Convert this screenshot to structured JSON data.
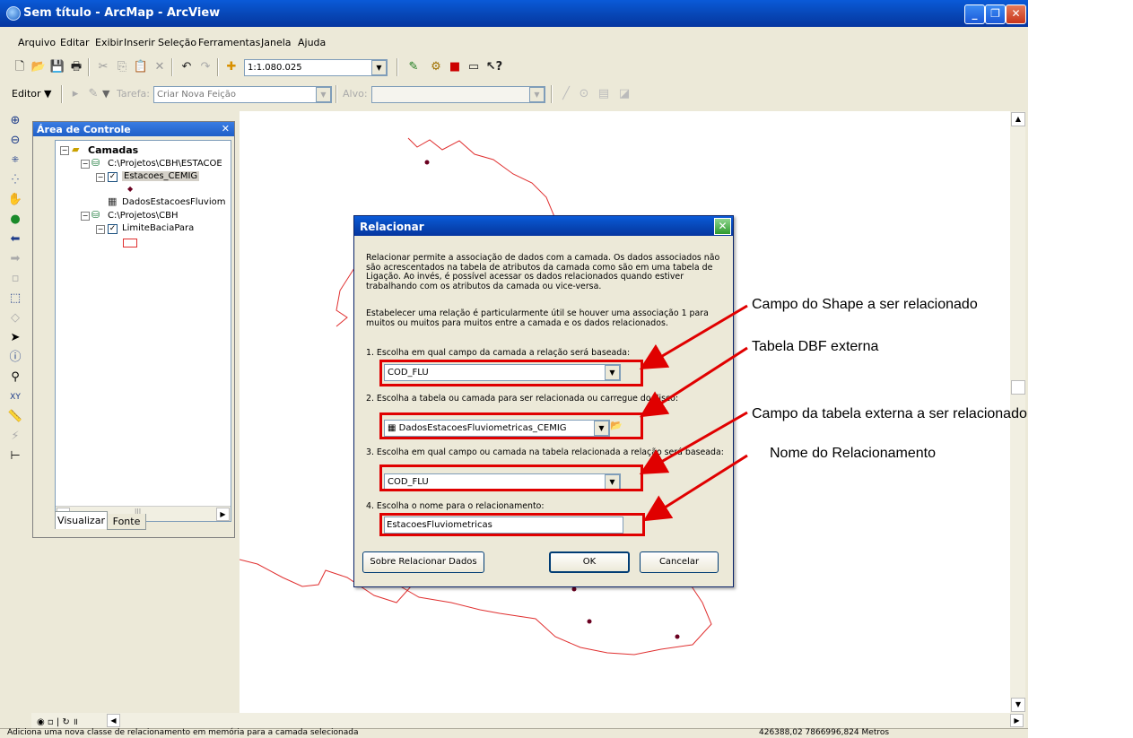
{
  "window": {
    "title": "Sem título - ArcMap - ArcView"
  },
  "menu": [
    "Arquivo",
    "Editar",
    "Exibir",
    "Inserir",
    "Seleção",
    "Ferramentas",
    "Janela",
    "Ajuda"
  ],
  "toolbar": {
    "scale": "1:1.080.025"
  },
  "editor": {
    "editor_label": "Editor",
    "task_label": "Tarefa:",
    "task_value": "Criar Nova Feição",
    "target_label": "Alvo:"
  },
  "toc": {
    "title": "Área de Controle",
    "root": "Camadas",
    "items": [
      "C:\\Projetos\\CBH\\ESTACOE",
      "Estacoes_CEMIG",
      "DadosEstacoesFluviom",
      "C:\\Projetos\\CBH",
      "LimiteBaciaPara"
    ],
    "tabs": [
      "Visualizar",
      "Fonte"
    ]
  },
  "dialog": {
    "title": "Relacionar",
    "para1": "Relacionar permite a associação de dados com a camada. Os dados associados não são acrescentados na tabela de atributos da camada como são em uma tabela de Ligação. Ao invés, é possível acessar os dados relacionados quando estiver trabalhando com os atributos da camada ou vice-versa.",
    "para2": "Estabelecer uma relação é particularmente útil se houver uma associação 1 para muitos ou muitos para muitos entre a camada e os dados relacionados.",
    "step1": "1. Escolha em qual campo da camada a relação será baseada:",
    "field1": "COD_FLU",
    "step2": "2. Escolha a tabela ou camada para ser relacionada ou carregue do disco:",
    "field2": "DadosEstacoesFluviometricas_CEMIG",
    "step3": "3. Escolha em qual campo ou camada na tabela relacionada a relação será baseada:",
    "field3": "COD_FLU",
    "step4": "4. Escolha o nome para o relacionamento:",
    "field4": "EstacoesFluviometricas",
    "about_button": "Sobre Relacionar Dados",
    "ok_button": "OK",
    "cancel_button": "Cancelar"
  },
  "callouts": [
    "Campo do Shape a ser relacionado",
    "Tabela DBF externa",
    "Campo da tabela externa a ser relacionado",
    "Nome do Relacionamento"
  ],
  "status": {
    "message": "Adiciona uma nova classe de relacionamento em memória para a camada selecionada",
    "coords": "426388,02  7866996,824 Metros"
  },
  "colors": {
    "highlight": "#e00000",
    "titlebar": "#0746b5"
  }
}
